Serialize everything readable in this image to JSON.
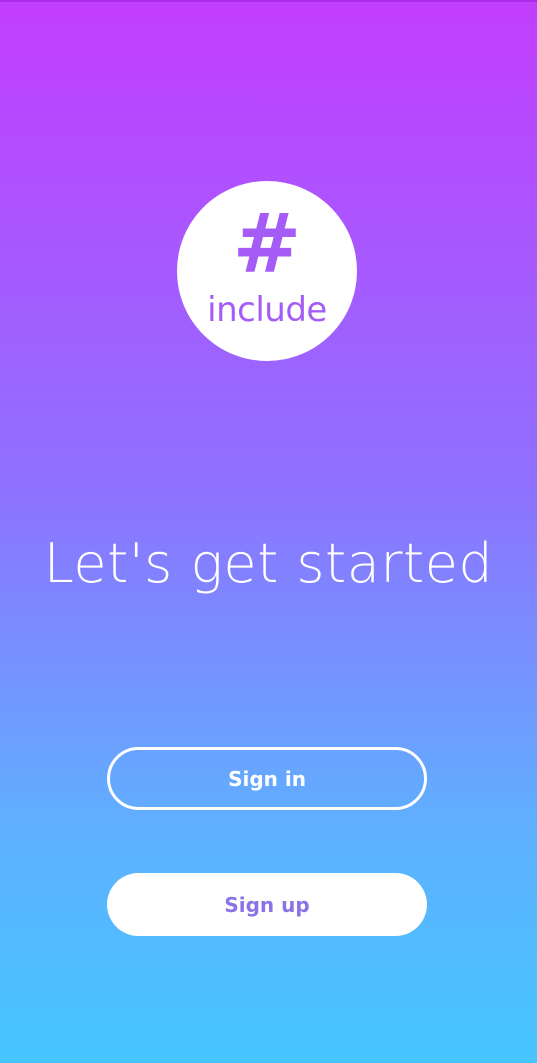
{
  "logo": {
    "symbol": "#",
    "word": "include",
    "color": "#a55cf7"
  },
  "headline": "Let's get started",
  "buttons": {
    "sign_in": "Sign in",
    "sign_up": "Sign up",
    "sign_up_text_color": "#8a73e6"
  },
  "colors": {
    "gradient_top": "#c33dff",
    "gradient_bottom": "#45c6ff"
  }
}
